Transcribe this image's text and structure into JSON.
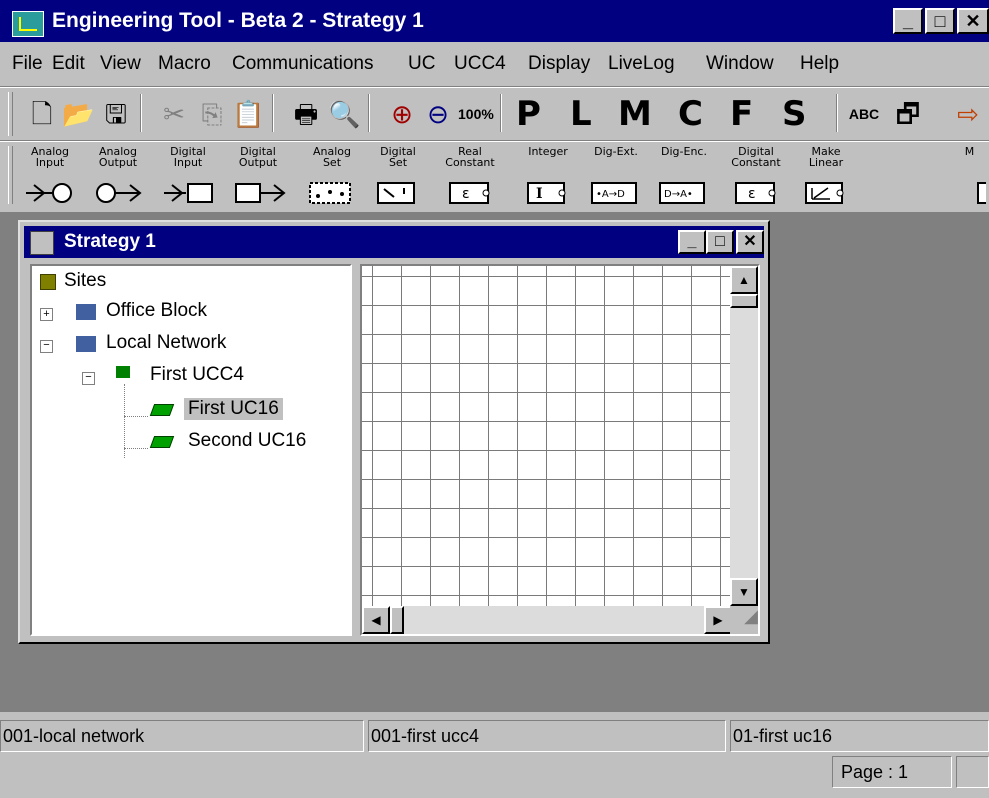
{
  "window": {
    "title": "Engineering Tool - Beta 2 - Strategy 1"
  },
  "menu": [
    "File",
    "Edit",
    "View",
    "Macro",
    "Communications",
    "UC",
    "UCC4",
    "Display",
    "LiveLog",
    "Window",
    "Help"
  ],
  "toolbar": {
    "zoom_label": "100%",
    "letters": [
      "P",
      "L",
      "M",
      "C",
      "F",
      "S"
    ],
    "abc_label": "ABC"
  },
  "palette": [
    {
      "line1": "Analog",
      "line2": "Input"
    },
    {
      "line1": "Analog",
      "line2": "Output"
    },
    {
      "line1": "Digital",
      "line2": "Input"
    },
    {
      "line1": "Digital",
      "line2": "Output"
    },
    {
      "line1": "Analog",
      "line2": "Set"
    },
    {
      "line1": "Digital",
      "line2": "Set"
    },
    {
      "line1": "Real",
      "line2": "Constant"
    },
    {
      "line1": "Integer",
      "line2": ""
    },
    {
      "line1": "Dig-Ext.",
      "line2": ""
    },
    {
      "line1": "Dig-Enc.",
      "line2": ""
    },
    {
      "line1": "Digital",
      "line2": "Constant"
    },
    {
      "line1": "Make",
      "line2": "Linear"
    },
    {
      "line1": "M",
      "line2": ""
    }
  ],
  "child_window": {
    "title": "Strategy 1"
  },
  "tree": {
    "root": "Sites",
    "nodes": [
      "Office Block",
      "Local Network",
      "First UCC4",
      "First UC16",
      "Second UC16"
    ]
  },
  "status": {
    "panel1": "001-local network",
    "panel2": "001-first ucc4",
    "panel3": "01-first uc16",
    "page": "Page : 1"
  },
  "colors": {
    "titlebar": "#000080",
    "desktop": "#808080",
    "face": "#c0c0c0"
  }
}
